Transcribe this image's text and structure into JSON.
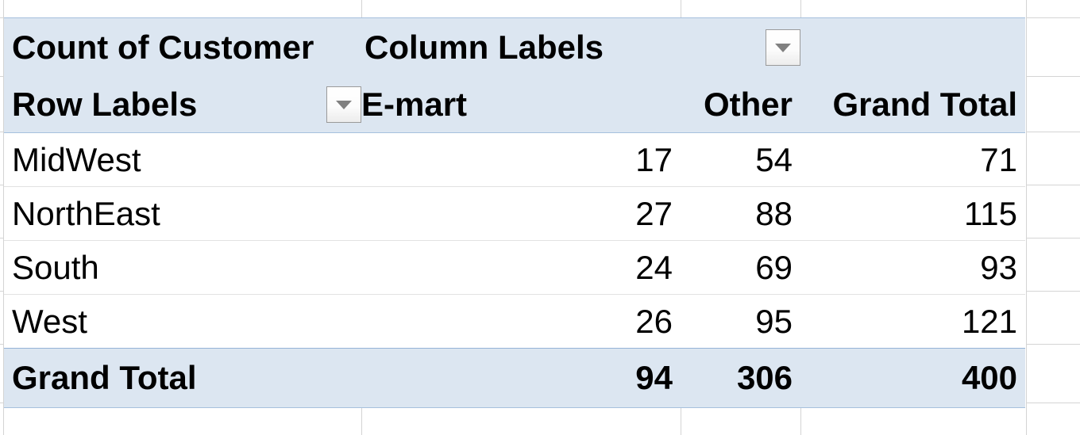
{
  "pivot": {
    "value_field_label": "Count of Customer",
    "column_labels_header": "Column Labels",
    "row_labels_header": "Row Labels",
    "column_headers": [
      "E-mart",
      "Other",
      "Grand Total"
    ],
    "rows": [
      {
        "label": "MidWest",
        "emart": "17",
        "other": "54",
        "grand_total": "71"
      },
      {
        "label": "NorthEast",
        "emart": "27",
        "other": "88",
        "grand_total": "115"
      },
      {
        "label": "South",
        "emart": "24",
        "other": "69",
        "grand_total": "93"
      },
      {
        "label": "West",
        "emart": "26",
        "other": "95",
        "grand_total": "121"
      }
    ],
    "grand_total_row": {
      "label": "Grand Total",
      "emart": "94",
      "other": "306",
      "grand_total": "400"
    },
    "filters": {
      "row_labels_filter_icon": "filter-dropdown-arrow",
      "column_labels_filter_icon": "filter-dropdown-arrow"
    },
    "colors": {
      "header_fill": "#DCE6F1",
      "total_fill": "#DCE6F1",
      "data_fill": "#FFFFFF",
      "text": "#000000",
      "gridline": "#D4D4D4"
    }
  },
  "chart_data": {
    "type": "table",
    "title": "Count of Customer",
    "row_field": "Row Labels",
    "column_field": "Column Labels",
    "categories": [
      "MidWest",
      "NorthEast",
      "South",
      "West"
    ],
    "series": [
      {
        "name": "E-mart",
        "values": [
          17,
          27,
          24,
          26
        ],
        "total": 94
      },
      {
        "name": "Other",
        "values": [
          54,
          88,
          69,
          95
        ],
        "total": 306
      }
    ],
    "row_totals": [
      71,
      115,
      93,
      121
    ],
    "grand_total": 400
  }
}
